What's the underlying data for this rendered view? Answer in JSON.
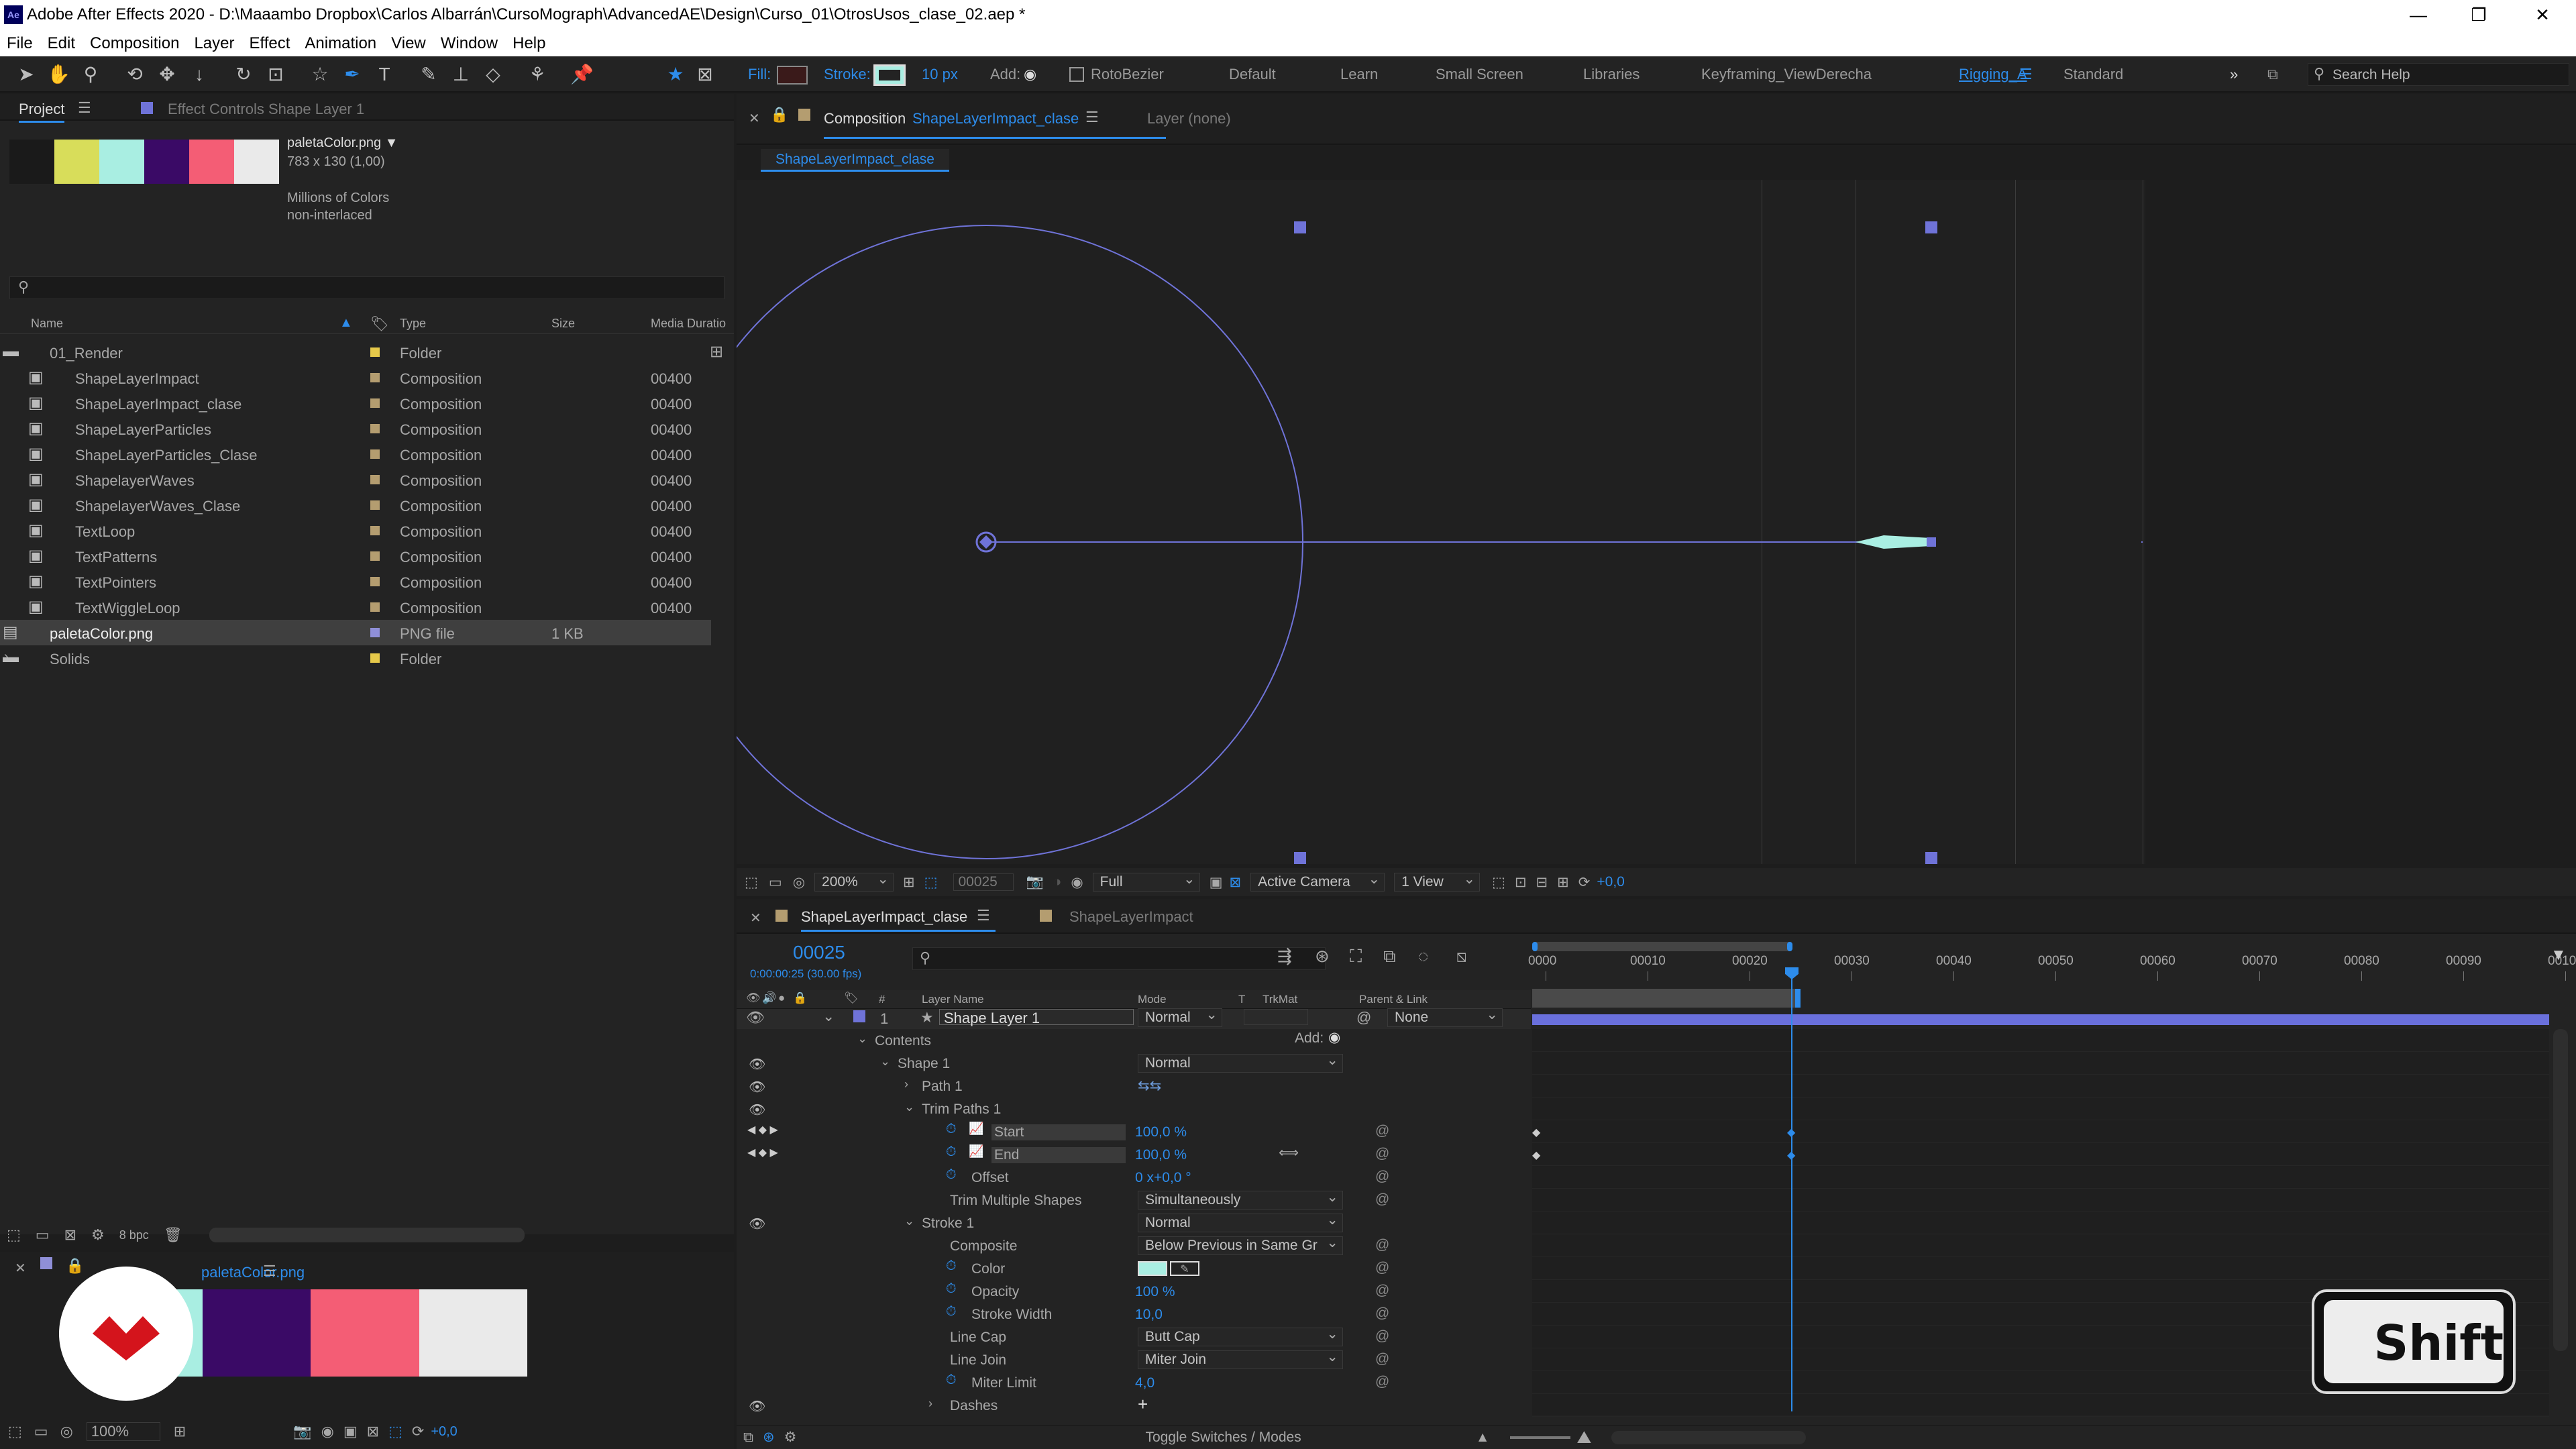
{
  "window": {
    "title": "Adobe After Effects 2020 - D:\\Maaambo Dropbox\\Carlos Albarrán\\CursoMograph\\AdvancedAE\\Design\\Curso_01\\OtrosUsos_clase_02.aep *",
    "app_badge": "Ae"
  },
  "menu": [
    "File",
    "Edit",
    "Composition",
    "Layer",
    "Effect",
    "Animation",
    "View",
    "Window",
    "Help"
  ],
  "toolbar": {
    "fill_label": "Fill:",
    "stroke_label": "Stroke:",
    "stroke_width": "10 px",
    "add_label": "Add:",
    "rotobezier": "RotoBezier",
    "workspaces": [
      "Default",
      "Learn",
      "Small Screen",
      "Libraries",
      "Keyframing_ViewDerecha",
      "Rigging_A",
      "Standard"
    ],
    "active_workspace": "Rigging_A",
    "search_help": "Search Help"
  },
  "project": {
    "tab": "Project",
    "effect_tab": "Effect Controls Shape Layer 1",
    "file_name": "paletaColor.png ▼",
    "file_dims": "783 x 130 (1,00)",
    "file_colors": "Millions of Colors",
    "file_interlace": "non-interlaced",
    "palette": [
      "#1a1a1a",
      "#d8dd5a",
      "#a9eee2",
      "#3a0a66",
      "#f45d75",
      "#eaeaea"
    ],
    "columns": {
      "name": "Name",
      "type": "Type",
      "size": "Size",
      "duration": "Media Duratio"
    },
    "items": [
      {
        "name": "01_Render",
        "type": "Folder",
        "size": "",
        "dur": "",
        "indent": 0,
        "kind": "folder",
        "color": "#e6c94a",
        "open": true
      },
      {
        "name": "ShapeLayerImpact",
        "type": "Composition",
        "size": "",
        "dur": "00400",
        "indent": 1,
        "kind": "comp",
        "color": "#b49d70"
      },
      {
        "name": "ShapeLayerImpact_clase",
        "type": "Composition",
        "size": "",
        "dur": "00400",
        "indent": 1,
        "kind": "comp",
        "color": "#b49d70"
      },
      {
        "name": "ShapeLayerParticles",
        "type": "Composition",
        "size": "",
        "dur": "00400",
        "indent": 1,
        "kind": "comp",
        "color": "#b49d70"
      },
      {
        "name": "ShapeLayerParticles_Clase",
        "type": "Composition",
        "size": "",
        "dur": "00400",
        "indent": 1,
        "kind": "comp",
        "color": "#b49d70"
      },
      {
        "name": "ShapelayerWaves",
        "type": "Composition",
        "size": "",
        "dur": "00400",
        "indent": 1,
        "kind": "comp",
        "color": "#b49d70"
      },
      {
        "name": "ShapelayerWaves_Clase",
        "type": "Composition",
        "size": "",
        "dur": "00400",
        "indent": 1,
        "kind": "comp",
        "color": "#b49d70"
      },
      {
        "name": "TextLoop",
        "type": "Composition",
        "size": "",
        "dur": "00400",
        "indent": 1,
        "kind": "comp",
        "color": "#b49d70"
      },
      {
        "name": "TextPatterns",
        "type": "Composition",
        "size": "",
        "dur": "00400",
        "indent": 1,
        "kind": "comp",
        "color": "#b49d70"
      },
      {
        "name": "TextPointers",
        "type": "Composition",
        "size": "",
        "dur": "00400",
        "indent": 1,
        "kind": "comp",
        "color": "#b49d70"
      },
      {
        "name": "TextWiggleLoop",
        "type": "Composition",
        "size": "",
        "dur": "00400",
        "indent": 1,
        "kind": "comp",
        "color": "#b49d70"
      },
      {
        "name": "paletaColor.png",
        "type": "PNG file",
        "size": "1 KB",
        "dur": "",
        "indent": 0,
        "kind": "png",
        "color": "#8f8fd8",
        "selected": true
      },
      {
        "name": "Solids",
        "type": "Folder",
        "size": "",
        "dur": "",
        "indent": 0,
        "kind": "folder",
        "color": "#e6c94a",
        "open": false
      }
    ],
    "bpc": "8 bpc"
  },
  "footage": {
    "tab": "paletaColor.png",
    "zoom": "100%",
    "exposure": "+0,0"
  },
  "composition": {
    "tab_prefix": "Composition",
    "tab_name": "ShapeLayerImpact_clase",
    "layer_tab": "Layer  (none)",
    "subtab": "ShapeLayerImpact_clase",
    "zoom": "200%",
    "frame": "00025",
    "quality": "Full",
    "camera": "Active Camera",
    "views": "1 View",
    "exposure": "+0,0"
  },
  "timeline": {
    "tabs": [
      "ShapeLayerImpact_clase",
      "ShapeLayerImpact"
    ],
    "timecode": "00025",
    "fps": "0:00:00:25 (30.00 fps)",
    "col": {
      "layer_name": "Layer Name",
      "mode": "Mode",
      "t": "T",
      "trkmat": "TrkMat",
      "parent": "Parent & Link"
    },
    "ruler": [
      "0000",
      "00010",
      "00020",
      "00030",
      "00040",
      "00050",
      "00060",
      "00070",
      "00080",
      "00090",
      "0010"
    ],
    "layer": {
      "num": "1",
      "name": "Shape Layer 1",
      "mode": "Normal",
      "parent": "None"
    },
    "rows": [
      {
        "label": "Contents",
        "indent": 1,
        "add": "Add:"
      },
      {
        "label": "Shape 1",
        "indent": 2,
        "mode": "Normal",
        "eye": true
      },
      {
        "label": "Path 1",
        "indent": 3,
        "eye": true
      },
      {
        "label": "Trim Paths 1",
        "indent": 3,
        "eye": true
      },
      {
        "label": "Start",
        "indent": 4,
        "value": "100,0 %",
        "kf": true
      },
      {
        "label": "End",
        "indent": 4,
        "value": "100,0 %",
        "kf": true
      },
      {
        "label": "Offset",
        "indent": 4,
        "value": "0 x+0,0 °"
      },
      {
        "label": "Trim Multiple Shapes",
        "indent": 4,
        "mode": "Simultaneously"
      },
      {
        "label": "Stroke 1",
        "indent": 3,
        "mode": "Normal",
        "eye": true
      },
      {
        "label": "Composite",
        "indent": 4,
        "mode": "Below Previous in Same Gr"
      },
      {
        "label": "Color",
        "indent": 4,
        "swatch": true
      },
      {
        "label": "Opacity",
        "indent": 4,
        "value": "100 %"
      },
      {
        "label": "Stroke Width",
        "indent": 4,
        "value": "10,0"
      },
      {
        "label": "Line Cap",
        "indent": 4,
        "mode": "Butt Cap"
      },
      {
        "label": "Line Join",
        "indent": 4,
        "mode": "Miter Join"
      },
      {
        "label": "Miter Limit",
        "indent": 4,
        "value": "4,0"
      },
      {
        "label": "Dashes",
        "indent": 4,
        "plus": true,
        "eye": true
      }
    ],
    "toggle": "Toggle Switches / Modes"
  },
  "key_overlay": "Shift",
  "colors": {
    "accent": "#2d8ceb",
    "shape": "#7a7fe0",
    "stroke_color": "#a9eee2"
  }
}
